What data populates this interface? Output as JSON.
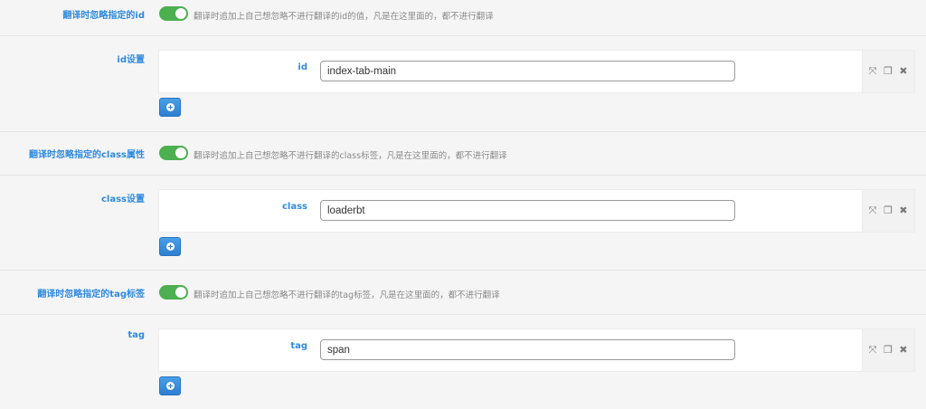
{
  "sections": [
    {
      "toggle_label": "翻译时忽略指定的id",
      "toggle_on": true,
      "toggle_hint": "翻译时追加上自己想忽略不进行翻译的id的值，凡是在这里面的，都不进行翻译",
      "list_label": "id设置",
      "field_label": "id",
      "field_value": "index-tab-main"
    },
    {
      "toggle_label": "翻译时忽略指定的class属性",
      "toggle_on": true,
      "toggle_hint": "翻译时追加上自己想忽略不进行翻译的class标签，凡是在这里面的，都不进行翻译",
      "list_label": "class设置",
      "field_label": "class",
      "field_value": "loaderbt"
    },
    {
      "toggle_label": "翻译时忽略指定的tag标签",
      "toggle_on": true,
      "toggle_hint": "翻译时追加上自己想忽略不进行翻译的tag标签，凡是在这里面的，都不进行翻译",
      "list_label": "tag",
      "field_label": "tag",
      "field_value": "span"
    }
  ],
  "icons": {
    "expand": "expand-icon",
    "copy": "copy-icon",
    "remove": "close-icon",
    "add": "plus-circle-icon"
  },
  "colors": {
    "label_blue": "#2f8ae0",
    "toggle_green": "#4caf50",
    "button_blue": "#2d7fd0"
  }
}
